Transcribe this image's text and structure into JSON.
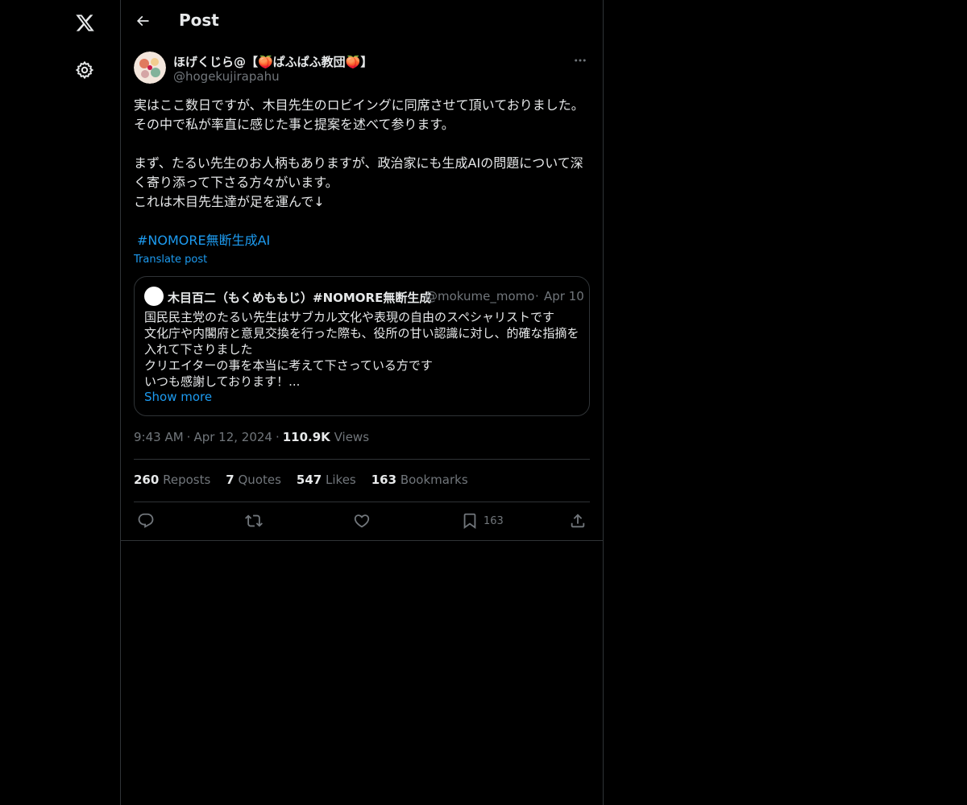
{
  "header": {
    "title": "Post"
  },
  "tweet": {
    "author_name": "ほげくじら@【🍑ぱふぱふ教団🍑】",
    "author_handle": "@hogekujirapahu",
    "text_lines": [
      "実はここ数日ですが、木目先生のロビイングに同席させて頂いておりました。その中で私が率直に感じた事と提案を述べて参ります。",
      "まず、たるい先生のお人柄もありますが、政治家にも生成AIの問題について深く寄り添って下さる方々がいます。",
      "これは木目先生達が足を運んで↓"
    ],
    "hashtag": "#NOMORE無断生成AI",
    "translate_label": "Translate post",
    "time": "9:43 AM",
    "date": "Apr 12, 2024",
    "views_count": "110.9K",
    "views_label": "Views",
    "stats": {
      "reposts_count": "260",
      "reposts_label": "Reposts",
      "quotes_count": "7",
      "quotes_label": "Quotes",
      "likes_count": "547",
      "likes_label": "Likes",
      "bookmarks_count": "163",
      "bookmarks_label": "Bookmarks"
    },
    "actions": {
      "bookmark_count": "163"
    }
  },
  "quote": {
    "author_name": "木目百二（もくめももじ）#NOMORE無断生成",
    "author_handle": "@mokume_momo",
    "separator": "·",
    "date": "Apr 10",
    "lines": [
      "国民民主党のたるい先生はサブカル文化や表現の自由のスペシャリストです",
      "文化庁や内閣府と意見交換を行った際も、役所の甘い認識に対し、的確な指摘を入れて下さりました",
      "クリエイターの事を本当に考えて下さっている方です",
      "いつも感謝しております！..."
    ],
    "show_more": "Show more"
  },
  "colors": {
    "background": "#000000",
    "text": "#e7e9ea",
    "muted": "#71767b",
    "accent": "#1d9bf0",
    "border": "#2f3336"
  },
  "icons": [
    "x-logo-icon",
    "gear-icon",
    "back-arrow-icon",
    "more-icon",
    "reply-icon",
    "retweet-icon",
    "like-icon",
    "bookmark-icon",
    "share-icon"
  ]
}
